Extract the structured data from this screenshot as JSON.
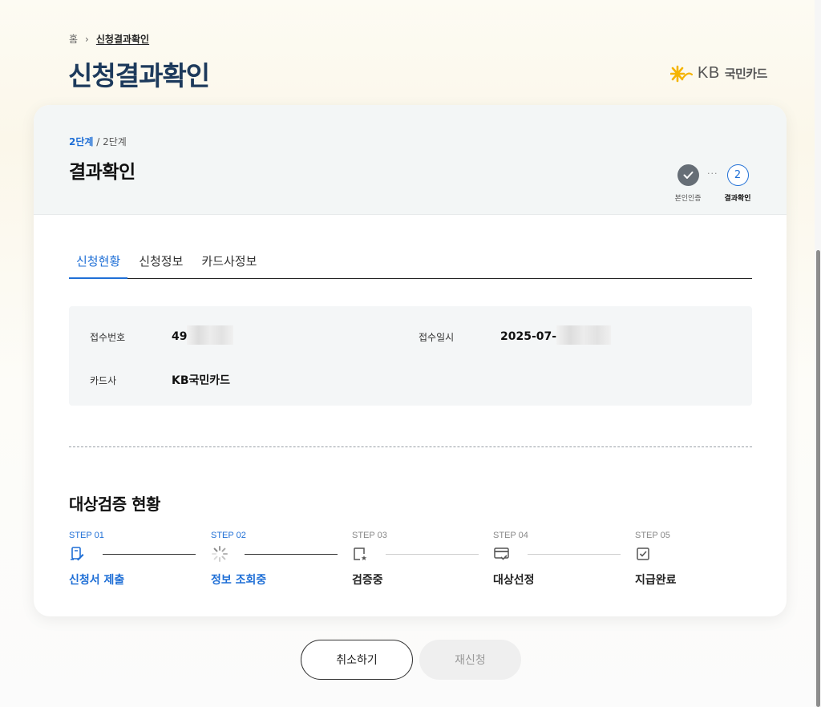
{
  "breadcrumb": {
    "home": "홈",
    "separator": "›",
    "current": "신청결과확인"
  },
  "page_title": "신청결과확인",
  "logo": {
    "mark": "KB",
    "name": "국민카드"
  },
  "card": {
    "step_current": "2단계",
    "step_total": " / 2단계",
    "title": "결과확인",
    "progress": {
      "steps": [
        {
          "label": "본인인증",
          "state": "done"
        },
        {
          "label": "결과확인",
          "number": "2",
          "state": "current"
        }
      ],
      "dots": "···"
    },
    "tabs": [
      {
        "label": "신청현황",
        "active": true
      },
      {
        "label": "신청정보",
        "active": false
      },
      {
        "label": "카드사정보",
        "active": false
      }
    ],
    "info": {
      "receipt_no_label": "접수번호",
      "receipt_no_value": "49",
      "receipt_date_label": "접수일시",
      "receipt_date_value": "2025-07-",
      "card_company_label": "카드사",
      "card_company_value": "KB국민카드"
    },
    "status": {
      "title": "대상검증 현황",
      "steps": [
        {
          "num": "STEP 01",
          "name": "신청서 제출",
          "icon": "form-pen-icon",
          "active": true
        },
        {
          "num": "STEP 02",
          "name": "정보 조회중",
          "icon": "loading-spinner-icon",
          "active": true
        },
        {
          "num": "STEP 03",
          "name": "검증중",
          "icon": "document-star-icon",
          "active": false
        },
        {
          "num": "STEP 04",
          "name": "대상선정",
          "icon": "card-check-icon",
          "active": false
        },
        {
          "num": "STEP 05",
          "name": "지급완료",
          "icon": "checkbox-icon",
          "active": false
        }
      ]
    }
  },
  "buttons": {
    "cancel": "취소하기",
    "reapply": "재신청"
  },
  "colors": {
    "accent": "#1f6fd6",
    "title": "#1d3a5c",
    "logo_star": "#f5b400"
  }
}
